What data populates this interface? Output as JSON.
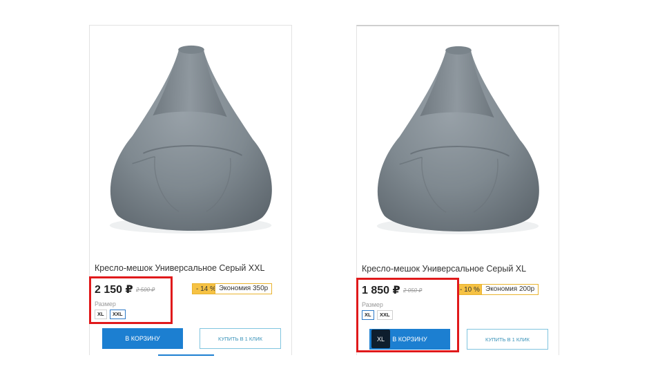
{
  "cards": [
    {
      "title": "Кресло-мешок Универсальное Серый XXL",
      "price": "2 150 ₽",
      "old_price": "2 500 ₽",
      "discount": "- 14 %",
      "savings": "Экономия 350р",
      "size_label": "Размер",
      "sizes": [
        "XL",
        "XXL"
      ],
      "selected_size": "XXL",
      "cart_label": "В корзину",
      "one_click_label": "Купить в 1 клик"
    },
    {
      "title": "Кресло-мешок Универсальное Серый XL",
      "price": "1 850 ₽",
      "old_price": "2 050 ₽",
      "discount": "- 10 %",
      "savings": "Экономия 200р",
      "size_label": "Размер",
      "sizes": [
        "XL",
        "XXL"
      ],
      "selected_size": "XL",
      "cart_label": "В корзину",
      "one_click_label": "Купить в 1 клик",
      "tooltip": "XL"
    }
  ],
  "colors": {
    "accent_blue": "#1c7fd1",
    "highlight_red": "#e0191b",
    "discount_yellow": "#f6c244",
    "product_gray": "#7e8890"
  }
}
